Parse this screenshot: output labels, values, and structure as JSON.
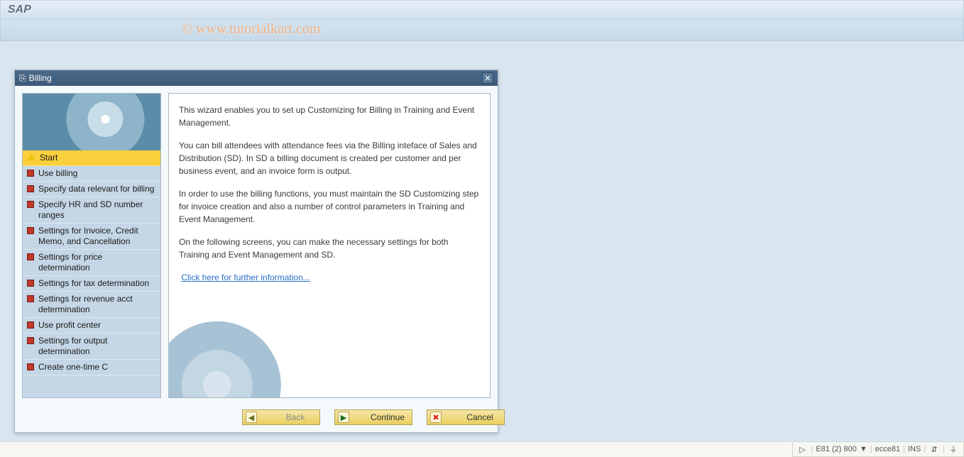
{
  "header": {
    "title": "SAP"
  },
  "watermark": "© www.tutorialkart.com",
  "dialog": {
    "title": "Billing",
    "sidebar": {
      "items": [
        {
          "label": "Start",
          "icon": "warn",
          "active": true
        },
        {
          "label": "Use billing",
          "icon": "red"
        },
        {
          "label": "Specify data relevant for billing",
          "icon": "red"
        },
        {
          "label": "Specify HR and SD number ranges",
          "icon": "red"
        },
        {
          "label": "Settings for Invoice, Credit Memo, and Cancellation",
          "icon": "red"
        },
        {
          "label": "Settings for price determination",
          "icon": "red"
        },
        {
          "label": "Settings for tax determination",
          "icon": "red"
        },
        {
          "label": "Settings for revenue acct determination",
          "icon": "red"
        },
        {
          "label": "Use profit center",
          "icon": "red"
        },
        {
          "label": "Settings for output determination",
          "icon": "red"
        },
        {
          "label": "Create one-time C",
          "icon": "red"
        }
      ]
    },
    "content": {
      "p1": "This wizard enables you to set up Customizing for Billing in Training and Event Management.",
      "p2": "You can bill attendees with attendance fees via the Billing inteface of Sales and Distribution (SD). In SD a billing document is created per customer and per business event, and an invoice form is output.",
      "p3": "In order to use the billing functions, you must maintain the SD Customizing step for invoice creation and also a number of control parameters in Training and Event Management.",
      "p4": "On the following screens, you can make the necessary settings for both Training and Event Management and SD.",
      "link": "Click here for further information..."
    },
    "buttons": {
      "back": "Back",
      "continue": "Continue",
      "cancel": "Cancel"
    }
  },
  "statusbar": {
    "triangle": "▷",
    "system": "E81 (2) 800",
    "dropdown": "▼",
    "server": "ecce81",
    "mode": "INS"
  }
}
